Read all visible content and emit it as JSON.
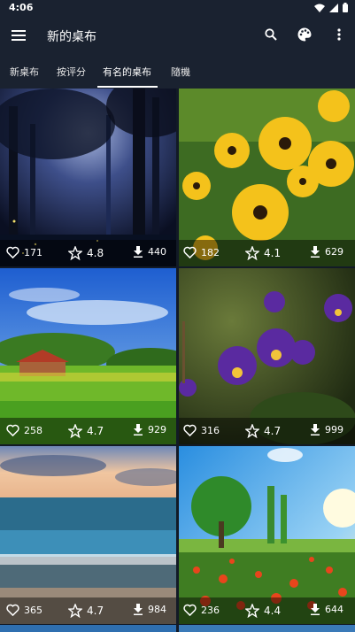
{
  "status_bar": {
    "time": "4:06"
  },
  "app_bar": {
    "title": "新的桌布"
  },
  "tabs": [
    {
      "label": "新桌布"
    },
    {
      "label": "按评分"
    },
    {
      "label": "有名的桌布",
      "selected": true
    },
    {
      "label": "隨機"
    }
  ],
  "wallpapers": [
    {
      "subject": "forest night",
      "likes": "171",
      "rating": "4.8",
      "downloads": "440"
    },
    {
      "subject": "sunflowers",
      "likes": "182",
      "rating": "4.1",
      "downloads": "629"
    },
    {
      "subject": "house meadow",
      "likes": "258",
      "rating": "4.7",
      "downloads": "929"
    },
    {
      "subject": "pansies",
      "likes": "316",
      "rating": "4.7",
      "downloads": "999"
    },
    {
      "subject": "sea sunset",
      "likes": "365",
      "rating": "4.7",
      "downloads": "984"
    },
    {
      "subject": "poppy field tree",
      "likes": "236",
      "rating": "4.4",
      "downloads": "644"
    }
  ],
  "icons": {
    "menu": "menu-icon",
    "search": "search-icon",
    "palette": "palette-icon",
    "more": "more-vert-icon",
    "like": "heart-icon",
    "rating": "star-icon",
    "download": "download-icon"
  }
}
